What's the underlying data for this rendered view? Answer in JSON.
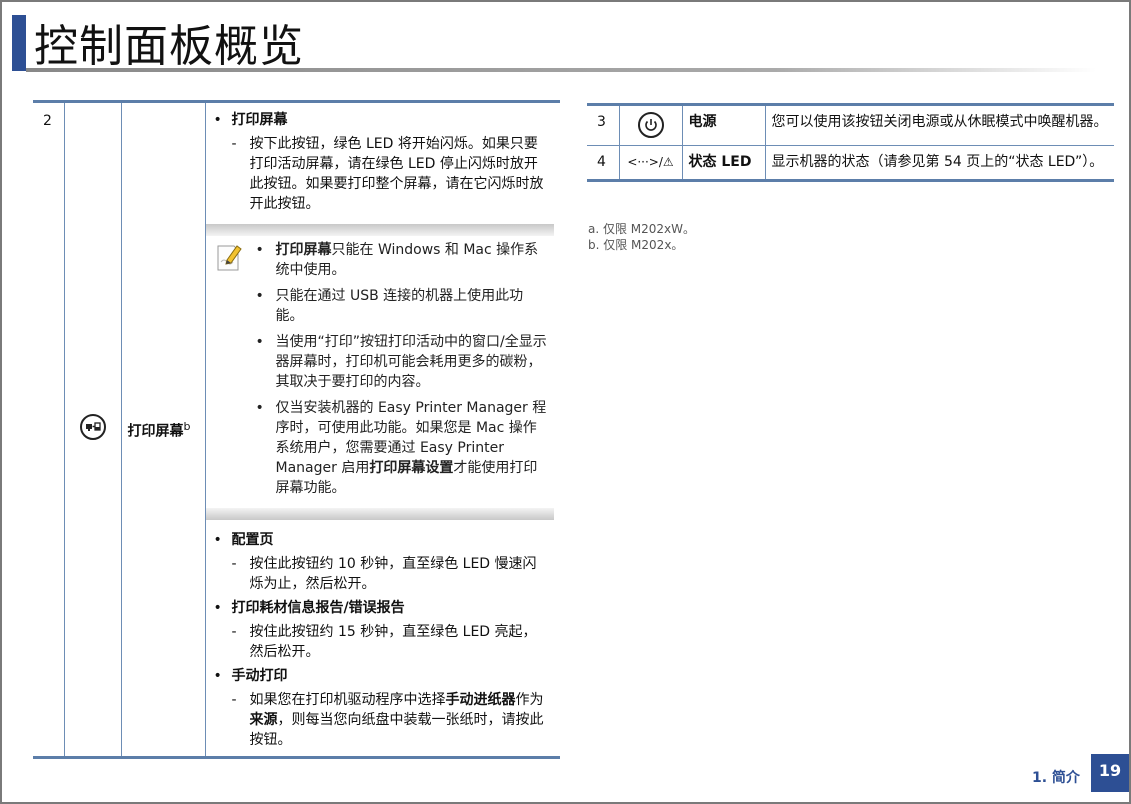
{
  "page_title": "控制面板概览",
  "main_row": {
    "number": "2",
    "icon": "print-screen-icon",
    "name": "打印屏幕",
    "name_sup": "b",
    "bullet1": {
      "title": "打印屏幕",
      "sub": "按下此按钮，绿色 LED 将开始闪烁。如果只要打印活动屏幕，请在绿色 LED 停止闪烁时放开此按钮。如果要打印整个屏幕，请在它闪烁时放开此按钮。"
    },
    "note": {
      "icon": "note-pencil-icon",
      "item1_bold": "打印屏幕",
      "item1_rest": "只能在 Windows 和 Mac 操作系统中使用。",
      "item2": "只能在通过 USB 连接的机器上使用此功能。",
      "item3": "当使用“打印”按钮打印活动中的窗口/全显示器屏幕时，打印机可能会耗用更多的碳粉，其取决于要打印的内容。",
      "item4_a": "仅当安装机器的 Easy Printer Manager 程序时，可使用此功能。如果您是 Mac 操作系统用户，您需要通过 Easy Printer Manager 启用",
      "item4_bold": "打印屏幕设置",
      "item4_b": "才能使用打印屏幕功能。"
    },
    "bullet2": {
      "title": "配置页",
      "sub": "按住此按钮约 10 秒钟，直至绿色 LED 慢速闪烁为止，然后松开。"
    },
    "bullet3": {
      "title": "打印耗材信息报告/错误报告",
      "sub": "按住此按钮约 15 秒钟，直至绿色 LED 亮起，然后松开。"
    },
    "bullet4": {
      "title": "手动打印",
      "sub_a": "如果您在打印机驱动程序中选择",
      "sub_bold1": "手动进纸器",
      "sub_b": "作为",
      "sub_bold2": "来源",
      "sub_c": "，则每当您向纸盘中装载一张纸时，请按此按钮。"
    }
  },
  "side_rows": [
    {
      "number": "3",
      "icon": "power-icon",
      "name": "电源",
      "desc": "您可以使用该按钮关闭电源或从休眠模式中唤醒机器。"
    },
    {
      "number": "4",
      "icon": "status-led-icon",
      "icon_text": "<···>/⚠",
      "name": "状态 LED",
      "desc": "显示机器的状态（请参见第 54 页上的“状态 LED”）。"
    }
  ],
  "footnotes": [
    "a. 仅限 M202xW。",
    "b. 仅限 M202x。"
  ],
  "footer": {
    "section": "1. 简介",
    "page_number": "19"
  },
  "colors": {
    "accent": "#2d4f94",
    "rule": "#5c7ea9"
  }
}
